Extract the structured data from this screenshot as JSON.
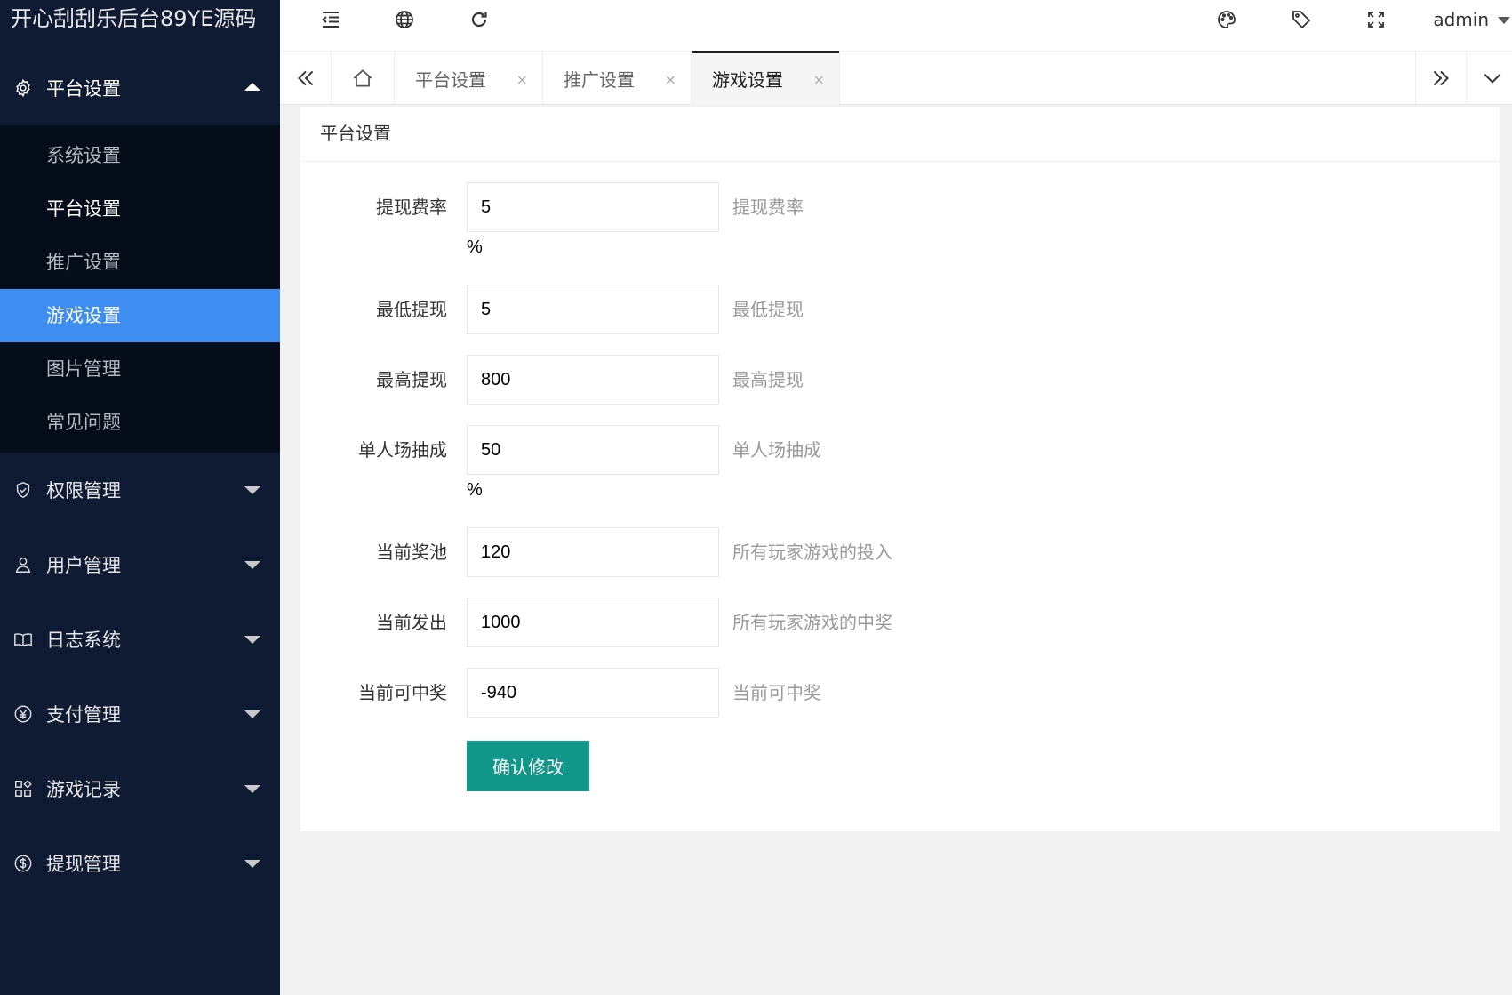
{
  "app": {
    "title": "开心刮刮乐后台89YE源码"
  },
  "sidebar": {
    "groups": [
      {
        "label": "平台设置",
        "icon": "gear-icon",
        "open": true,
        "items": [
          {
            "label": "系统设置"
          },
          {
            "label": "平台设置"
          },
          {
            "label": "推广设置"
          },
          {
            "label": "游戏设置",
            "active": true
          },
          {
            "label": "图片管理"
          },
          {
            "label": "常见问题"
          }
        ]
      },
      {
        "label": "权限管理",
        "icon": "shield-icon"
      },
      {
        "label": "用户管理",
        "icon": "user-icon"
      },
      {
        "label": "日志系统",
        "icon": "book-icon"
      },
      {
        "label": "支付管理",
        "icon": "yen-icon"
      },
      {
        "label": "游戏记录",
        "icon": "apps-icon"
      },
      {
        "label": "提现管理",
        "icon": "dollar-icon"
      }
    ]
  },
  "header": {
    "user": "admin"
  },
  "tabs": [
    {
      "label": "平台设置"
    },
    {
      "label": "推广设置"
    },
    {
      "label": "游戏设置",
      "active": true
    }
  ],
  "tab_close": "×",
  "card": {
    "title": "平台设置"
  },
  "form": {
    "fields": [
      {
        "label": "提现费率",
        "value": "5",
        "hint": "提现费率",
        "unit": "%"
      },
      {
        "label": "最低提现",
        "value": "5",
        "hint": "最低提现"
      },
      {
        "label": "最高提现",
        "value": "800",
        "hint": "最高提现"
      },
      {
        "label": "单人场抽成",
        "value": "50",
        "hint": "单人场抽成",
        "unit": "%"
      },
      {
        "label": "当前奖池",
        "value": "120",
        "hint": "所有玩家游戏的投入"
      },
      {
        "label": "当前发出",
        "value": "1000",
        "hint": "所有玩家游戏的中奖"
      },
      {
        "label": "当前可中奖",
        "value": "-940",
        "hint": "当前可中奖"
      }
    ],
    "submit_label": "确认修改"
  },
  "colors": {
    "sidebar_bg": "#0f1b33",
    "submenu_bg": "#050c1a",
    "active_item": "#3d8ef0",
    "submit_btn": "#11968a"
  }
}
